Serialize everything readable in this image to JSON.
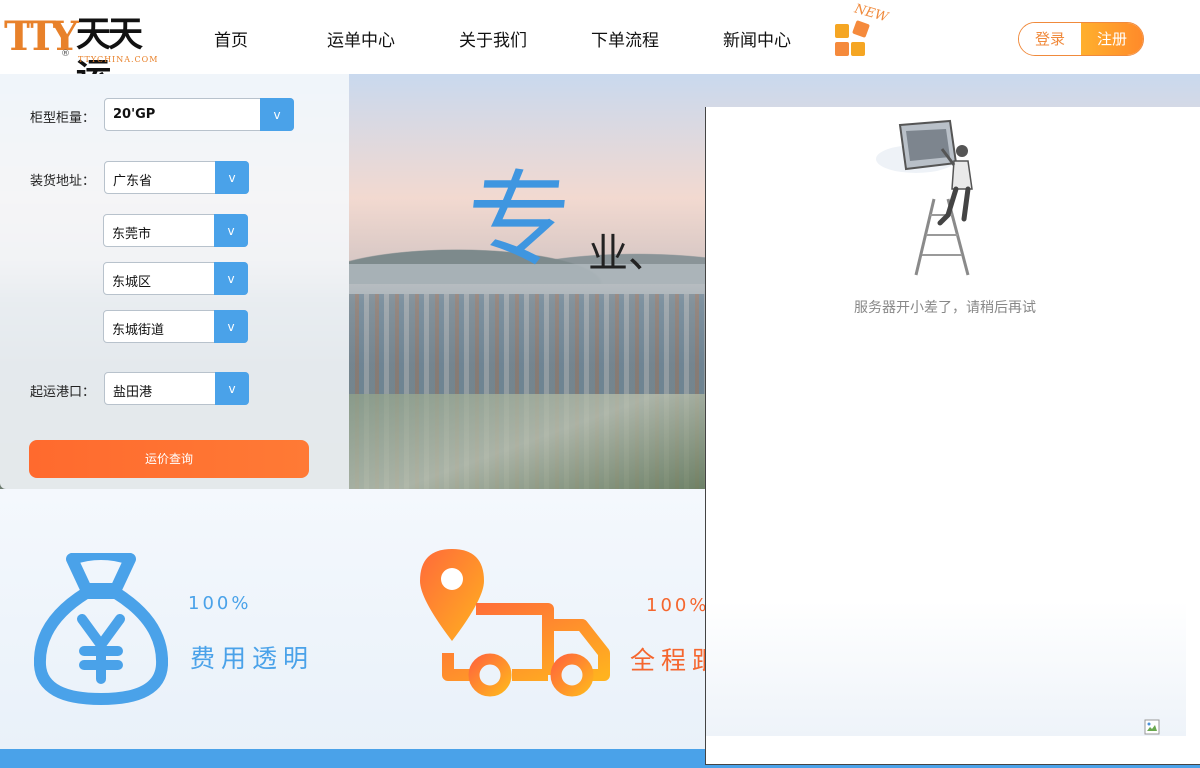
{
  "brand": {
    "logo_latin": "TTY",
    "logo_cn": "天天运",
    "logo_registered": "®",
    "logo_domain": "TTYCHINA.COM",
    "accent": "#e8812a"
  },
  "nav": {
    "items": [
      {
        "label": "首页"
      },
      {
        "label": "运单中心"
      },
      {
        "label": "关于我们"
      },
      {
        "label": "下单流程"
      },
      {
        "label": "新闻中心"
      }
    ],
    "new_badge": "NEW"
  },
  "auth": {
    "login_label": "登录",
    "register_label": "注册"
  },
  "hero": {
    "slogan_big": "专",
    "slogan_small": "业、"
  },
  "query": {
    "container_label": "柜型柜量：",
    "container_value": "20'GP",
    "loading_label": "装货地址：",
    "province": "广东省",
    "city": "东莞市",
    "district": "东城区",
    "street": "东城街道",
    "port_label": "起运港口：",
    "port": "盐田港",
    "dropdown_arrow": "v",
    "submit_label": "运价查询"
  },
  "features": [
    {
      "percent": "100%",
      "title": "费用透明",
      "color": "#4aa2e9",
      "icon": "money-bag-icon"
    },
    {
      "percent": "100%",
      "title": "全程跟",
      "color": "#f58a3c",
      "icon": "delivery-truck-icon"
    }
  ],
  "error": {
    "message": "服务器开小差了，请稍后再试",
    "illustration": "worker-on-ladder-icon"
  },
  "colors": {
    "primary_blue": "#4aa2e9",
    "orange": "#ff6a2e"
  }
}
